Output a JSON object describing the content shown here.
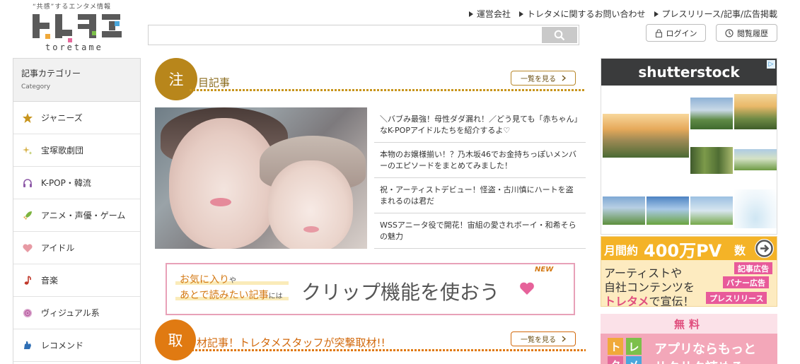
{
  "brand": {
    "tagline": "“共感”するエンタメ情報",
    "logo_text": "トレタメ",
    "logo_word": "toretame"
  },
  "header": {
    "links": [
      "運営会社",
      "トレタメに関するお問い合わせ",
      "プレスリリース/記事/広告掲載"
    ],
    "search_placeholder": "",
    "login_label": "ログイン",
    "history_label": "閲覧履歴"
  },
  "sidebar": {
    "title": "記事カテゴリー",
    "subtitle": "Category",
    "items": [
      {
        "label": "ジャニーズ",
        "icon": "star-icon",
        "color": "#c8951e"
      },
      {
        "label": "宝塚歌劇団",
        "icon": "sparkle-icon",
        "color": "#d7b24a"
      },
      {
        "label": "K-POP・韓流",
        "icon": "headphones-icon",
        "color": "#8e5aa8"
      },
      {
        "label": "アニメ・声優・ゲーム",
        "icon": "rocket-icon",
        "color": "#7db43f"
      },
      {
        "label": "アイドル",
        "icon": "heart-icon",
        "color": "#e79aa4"
      },
      {
        "label": "音楽",
        "icon": "music-note-icon",
        "color": "#c0392b"
      },
      {
        "label": "ヴィジュアル系",
        "icon": "rose-icon",
        "color": "#b85aa0"
      },
      {
        "label": "レコメンド",
        "icon": "hand-icon",
        "color": "#2f6fb5"
      }
    ]
  },
  "featured": {
    "circle_char": "注",
    "title": "目記事",
    "more_label": "一覧を見る",
    "articles": [
      "＼バブみ最強！母性ダダ漏れ！／どう見ても「赤ちゃん」なK-POPアイドルたちを紹介するよ♡",
      "本物のお嬢様揃い！？乃木坂46でお金持ちっぽいメンバーのエピソードをまとめてみました！",
      "祝・アーティストデビュー！怪盗・古川慎にハートを盗まれるのは君だ",
      "WSSアニータ役で開花！宙組の愛されボーイ・和希そらの魅力"
    ]
  },
  "clip_banner": {
    "line1_em": "お気に入り",
    "line1_small": "や",
    "line2_a": "あとで",
    "line2_b": "読みたい記事",
    "line2_small": "には",
    "big": "クリップ機能を使おう",
    "badge": "NEW"
  },
  "coverage": {
    "circle_char": "取",
    "title": "材記事！トレタメスタッフが突撃取材!!",
    "more_label": "一覧を見る"
  },
  "ads": {
    "shutterstock_brand": "shutterstock",
    "adchoice": "▷",
    "pv": {
      "t1": "月間約",
      "t2": "400万PV",
      "t3": "数",
      "line1": "アーティストや",
      "line2": "自社コンテンツを",
      "line3_em": "トレタメ",
      "line3": "で宣伝！",
      "tags": [
        "記事広告",
        "バナー広告",
        "プレスリリース"
      ]
    },
    "app": {
      "top": "無料",
      "text1": "アプリならもっと",
      "text2": "サクサク読める"
    }
  },
  "colors": {
    "accent": "#c8951e",
    "coverage_accent": "#e07a12"
  }
}
